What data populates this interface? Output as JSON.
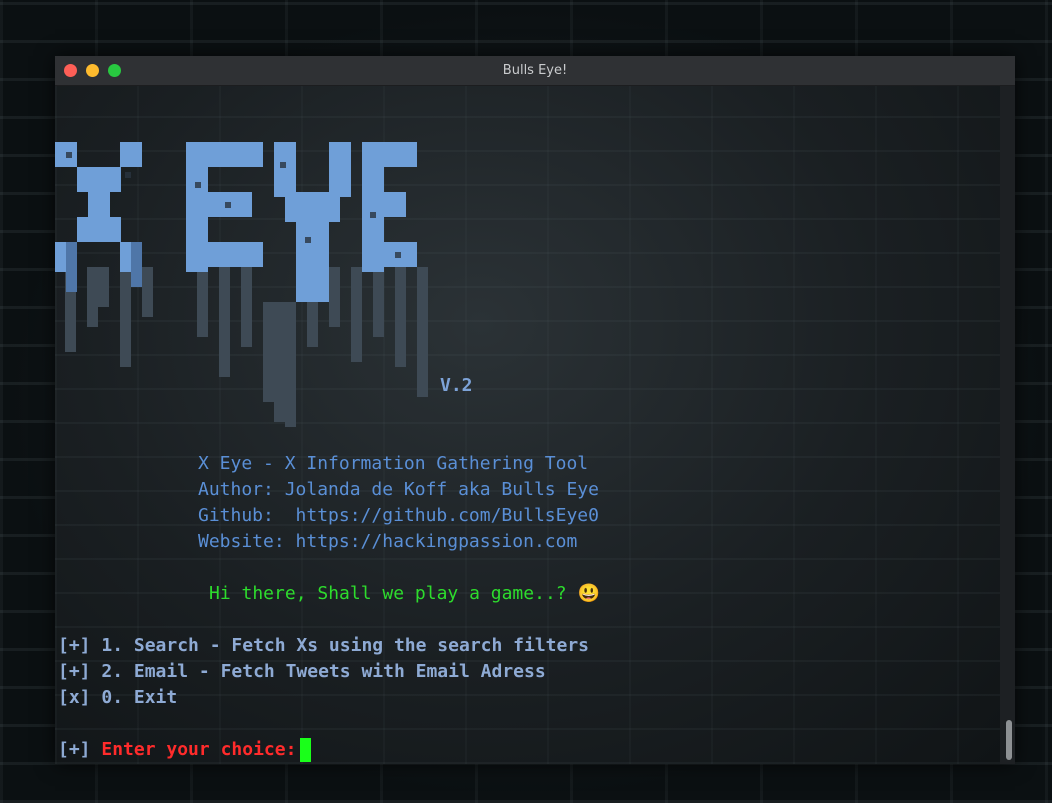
{
  "window": {
    "title": "Bulls Eye!"
  },
  "banner": {
    "version": "V.2",
    "info": [
      "X Eye - X Information Gathering Tool",
      "Author: Jolanda de Koff aka Bulls Eye",
      "Github:  https://github.com/BullsEye0",
      "Website: https://hackingpassion.com"
    ],
    "greeting": "Hi there, Shall we play a game..? 😃"
  },
  "menu": {
    "items": [
      {
        "marker": "[+]",
        "label": "1. Search - Fetch Xs using the search filters"
      },
      {
        "marker": "[+]",
        "label": "2. Email - Fetch Tweets with Email Adress"
      },
      {
        "marker": "[x]",
        "label": "0. Exit"
      }
    ]
  },
  "prompt": {
    "marker": "[+]",
    "text": "Enter your choice:"
  },
  "colors": {
    "info_text": "#5a8fd6",
    "menu_text": "#8eaad4",
    "greeting_text": "#2ddc2d",
    "prompt_text": "#ff2b2b",
    "cursor": "#1aff1a"
  }
}
